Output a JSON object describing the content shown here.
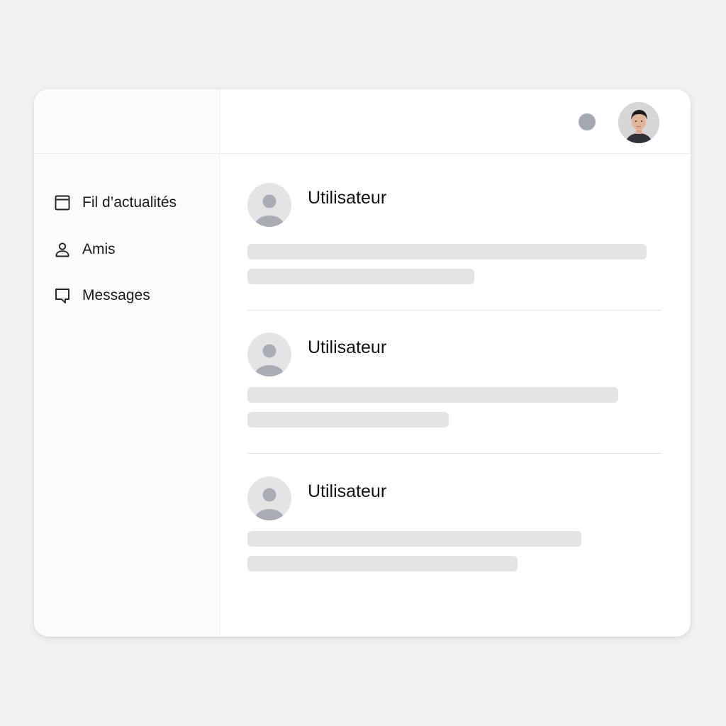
{
  "sidebar": {
    "items": [
      {
        "label": "Fil d’actualités",
        "icon": "newspaper-icon"
      },
      {
        "label": "Amis",
        "icon": "person-icon"
      },
      {
        "label": "Messages",
        "icon": "chat-bubble-icon"
      }
    ]
  },
  "topbar": {
    "status_icon": "status-dot-icon",
    "avatar_icon": "user-profile-photo"
  },
  "feed": {
    "posts": [
      {
        "username": "Utilisateur"
      },
      {
        "username": "Utilisateur"
      },
      {
        "username": "Utilisateur"
      }
    ]
  },
  "colors": {
    "background": "#f2f2f2",
    "window": "#ffffff",
    "sidebar": "#fbfbfb",
    "skeleton": "#e4e4e5",
    "avatar_placeholder": "#e3e4e6",
    "avatar_figure": "#a9adb3",
    "status_dot": "#a3a9b1"
  }
}
